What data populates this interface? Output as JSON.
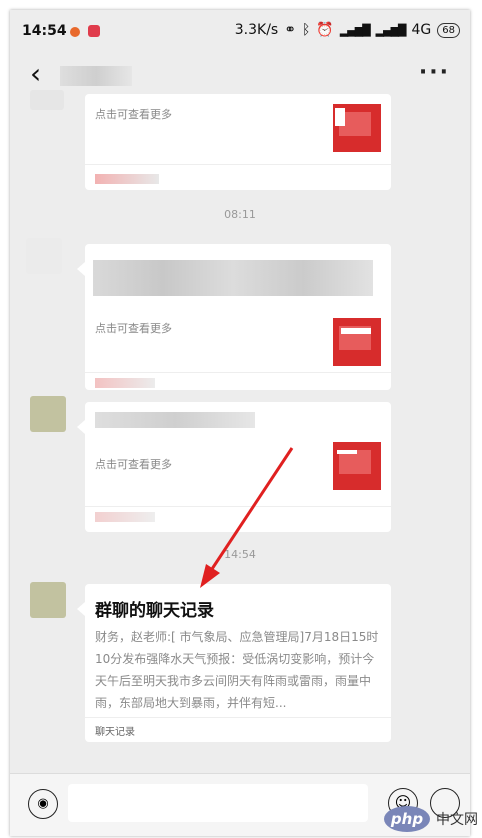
{
  "status_bar": {
    "time": "14:54",
    "network_speed": "3.3K/s",
    "network_type": "4G",
    "battery": "68"
  },
  "chat": {
    "hint_text": "点击可查看更多",
    "time_separators": [
      "08:11",
      "14:54"
    ],
    "chat_history": {
      "title": "群聊的聊天记录",
      "body": "财务，赵老师:[ 市气象局、应急管理局]7月18日15时10分发布强降水天气预报：受低涡切变影响，预计今天午后至明天我市多云间阴天有阵雨或雷雨，雨量中雨，东部局地大到暴雨，并伴有短...",
      "footer": "聊天记录"
    }
  },
  "watermark": {
    "logo": "php",
    "site": "中文网"
  },
  "colors": {
    "background": "#ededed",
    "card": "#ffffff",
    "thumbnail_red": "#d72c2c",
    "arrow_red": "#e02020"
  }
}
